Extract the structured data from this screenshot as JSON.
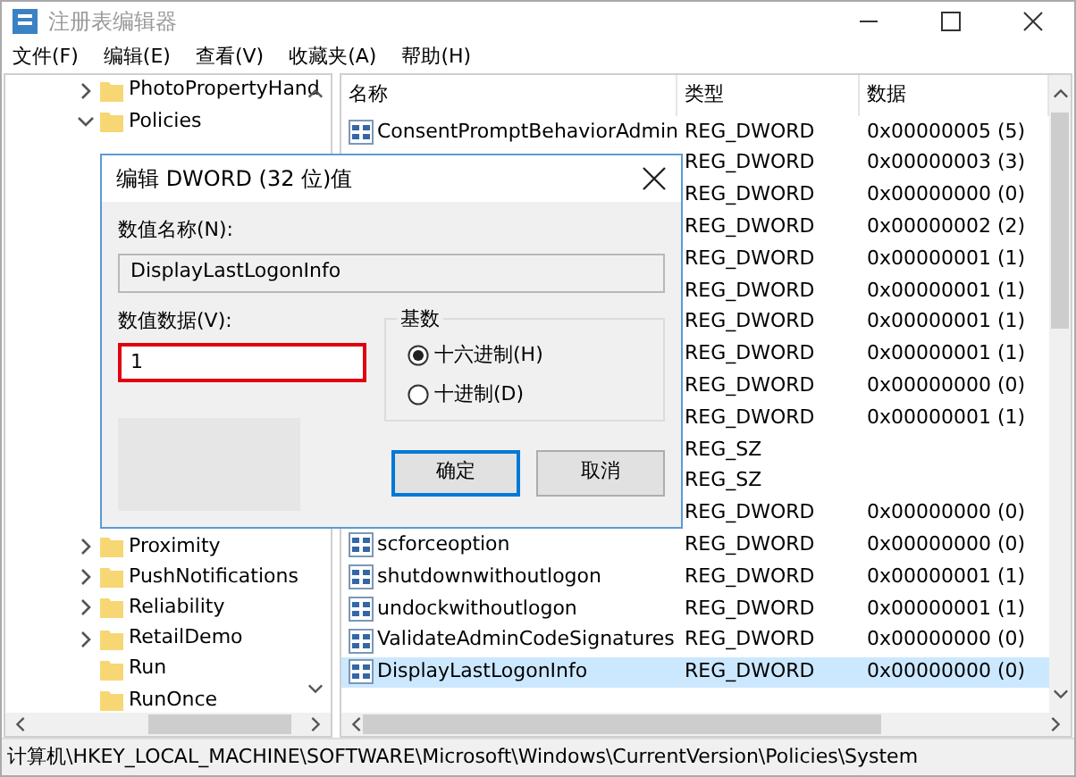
{
  "window": {
    "title": "注册表编辑器"
  },
  "menu": [
    "文件(F)",
    "编辑(E)",
    "查看(V)",
    "收藏夹(A)",
    "帮助(H)"
  ],
  "tree": [
    {
      "label": "PhotoPropertyHand",
      "expandable": true,
      "expanded": false
    },
    {
      "label": "Policies",
      "expandable": true,
      "expanded": true
    },
    {
      "label": "Proximity",
      "expandable": true,
      "expanded": false
    },
    {
      "label": "PushNotifications",
      "expandable": true,
      "expanded": false
    },
    {
      "label": "Reliability",
      "expandable": true,
      "expanded": false
    },
    {
      "label": "RetailDemo",
      "expandable": true,
      "expanded": false
    },
    {
      "label": "Run",
      "expandable": false
    },
    {
      "label": "RunOnce",
      "expandable": false
    }
  ],
  "table": {
    "columns": [
      "名称",
      "类型",
      "数据"
    ],
    "rows": [
      {
        "name": "ConsentPromptBehaviorAdmin",
        "type": "REG_DWORD",
        "data": "0x00000005 (5)",
        "selected": false
      },
      {
        "type": "REG_DWORD",
        "data": "0x00000003 (3)",
        "selected": false
      },
      {
        "type": "REG_DWORD",
        "data": "0x00000000 (0)",
        "selected": false
      },
      {
        "type": "REG_DWORD",
        "data": "0x00000002 (2)",
        "selected": false
      },
      {
        "type": "REG_DWORD",
        "data": "0x00000001 (1)",
        "selected": false
      },
      {
        "type": "REG_DWORD",
        "data": "0x00000001 (1)",
        "selected": false
      },
      {
        "type": "REG_DWORD",
        "data": "0x00000001 (1)",
        "selected": false
      },
      {
        "type": "REG_DWORD",
        "data": "0x00000001 (1)",
        "selected": false
      },
      {
        "type": "REG_DWORD",
        "data": "0x00000000 (0)",
        "selected": false
      },
      {
        "type": "REG_DWORD",
        "data": "0x00000001 (1)",
        "selected": false
      },
      {
        "type": "REG_SZ",
        "selected": false
      },
      {
        "type": "REG_SZ",
        "selected": false
      },
      {
        "type": "REG_DWORD",
        "data": "0x00000000 (0)",
        "selected": false
      },
      {
        "name": "scforceoption",
        "type": "REG_DWORD",
        "data": "0x00000000 (0)",
        "selected": false
      },
      {
        "name": "shutdownwithoutlogon",
        "type": "REG_DWORD",
        "data": "0x00000001 (1)",
        "selected": false
      },
      {
        "name": "undockwithoutlogon",
        "type": "REG_DWORD",
        "data": "0x00000001 (1)",
        "selected": false
      },
      {
        "name": "ValidateAdminCodeSignatures",
        "type": "REG_DWORD",
        "data": "0x00000000 (0)",
        "selected": false
      },
      {
        "name": "DisplayLastLogonInfo",
        "type": "REG_DWORD",
        "data": "0x00000000 (0)",
        "selected": true
      }
    ]
  },
  "dialog": {
    "title": "编辑 DWORD (32 位)值",
    "name_label": "数值名称(N):",
    "name_value": "DisplayLastLogonInfo",
    "data_label": "数值数据(V):",
    "data_value": "1",
    "data_highlighted": true,
    "base_label": "基数",
    "bases": [
      {
        "label": "十六进制(H)",
        "selected": true
      },
      {
        "label": "十进制(D)",
        "selected": false
      }
    ],
    "buttons": [
      {
        "label": "确定",
        "default": true
      },
      {
        "label": "取消",
        "default": false
      }
    ]
  },
  "status_bar": "计算机\\HKEY_LOCAL_MACHINE\\SOFTWARE\\Microsoft\\Windows\\CurrentVersion\\Policies\\System"
}
